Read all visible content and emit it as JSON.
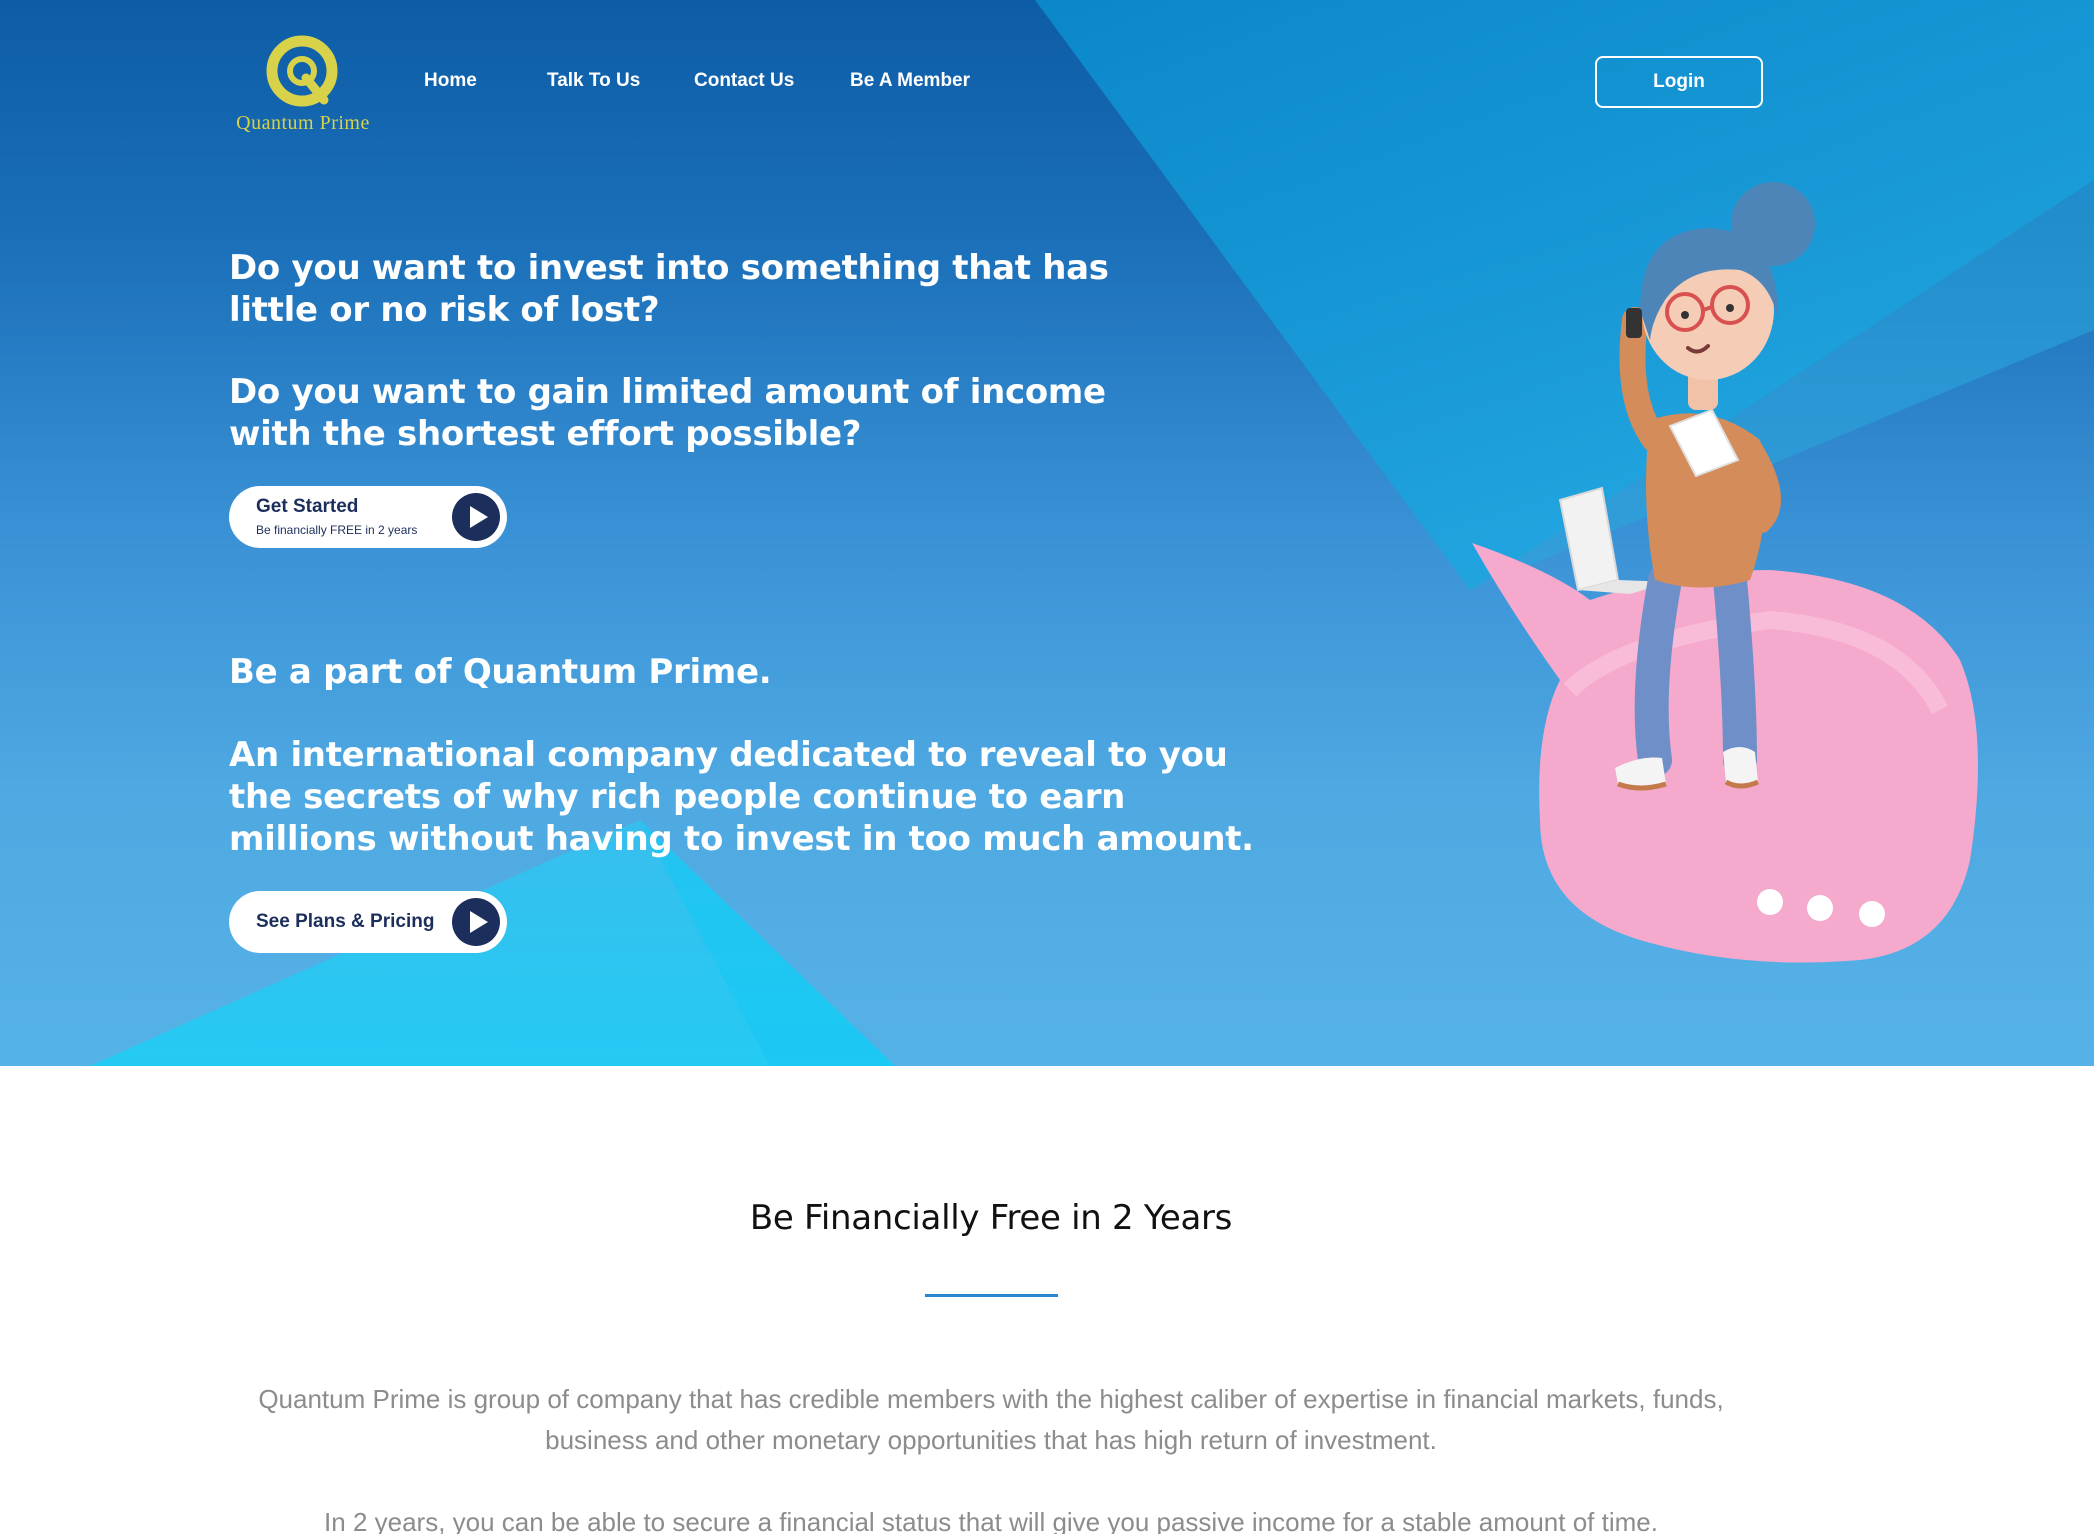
{
  "brand": {
    "name": "Quantum Prime",
    "logo_color": "#d8d24a"
  },
  "nav": {
    "items": [
      {
        "label": "Home"
      },
      {
        "label": "Talk To Us"
      },
      {
        "label": "Contact Us"
      },
      {
        "label": "Be A Member"
      }
    ],
    "login_label": "Login"
  },
  "hero": {
    "question1": [
      "Do you want to invest into something that has",
      "little or no risk of lost?"
    ],
    "question2": [
      "Do you want to gain limited amount of income",
      "with the shortest effort possible?"
    ],
    "cta_primary": {
      "title": "Get Started",
      "subtitle": "Be financially FREE in 2 years",
      "icon": "play-icon"
    },
    "heading2": "Be a part of Quantum Prime.",
    "description": [
      "An international company dedicated to reveal to you",
      "the secrets of why rich people continue to earn",
      "millions without having to invest in too much amount."
    ],
    "cta_secondary": {
      "title": "See Plans & Pricing",
      "icon": "play-icon"
    },
    "illustration": "woman-sitting-on-pink-chat-bubble-with-laptop-and-phone"
  },
  "about": {
    "title": "Be Financially Free in 2 Years",
    "paragraph1": [
      "Quantum Prime is group of company that has credible members with the highest caliber of expertise in financial markets, funds,",
      "business and other monetary opportunities that has high return of investment."
    ],
    "paragraph2": "In 2 years, you can be able to secure a financial status that will give you passive income for a stable amount of time."
  },
  "colors": {
    "hero_dark": "#0d5ca6",
    "hero_light": "#55b2e6",
    "button_navy": "#1c2e5c",
    "accent_line": "#2a86cf",
    "body_text": "#8c8c8c",
    "bubble_pink": "#f7b3d4"
  }
}
